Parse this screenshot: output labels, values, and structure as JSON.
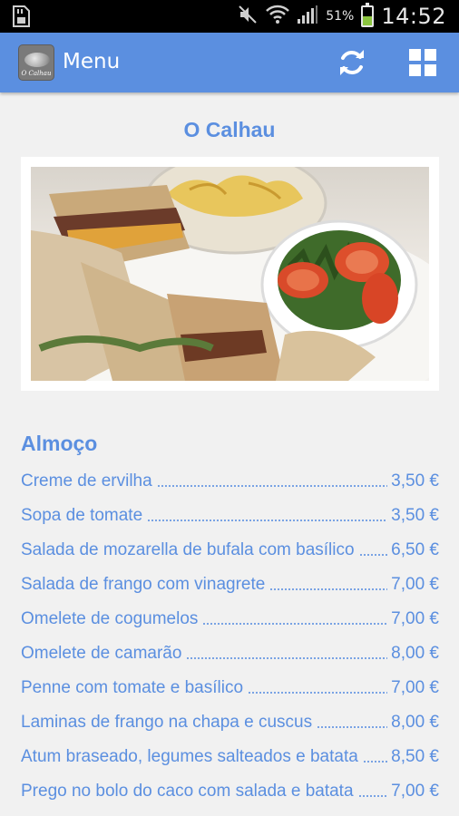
{
  "status_bar": {
    "battery_percent": "51%",
    "battery_level": 0.51,
    "time": "14:52",
    "icons": [
      "sd-card-icon",
      "mute-icon",
      "wifi-icon",
      "signal-icon",
      "battery-icon"
    ]
  },
  "action_bar": {
    "logo_text": "O Calhau",
    "title": "Menu",
    "refresh_icon": "refresh-icon",
    "grid_icon": "grid-icon"
  },
  "restaurant": {
    "name": "O Calhau"
  },
  "section": {
    "title": "Almoço",
    "items": [
      {
        "name": "Creme de ervilha",
        "price": "3,50 €"
      },
      {
        "name": "Sopa de tomate",
        "price": "3,50 €"
      },
      {
        "name": "Salada de mozarella de bufala com basílico",
        "price": "6,50 €"
      },
      {
        "name": "Salada de frango com vinagrete",
        "price": "7,00 €"
      },
      {
        "name": "Omelete de cogumelos",
        "price": "7,00 €"
      },
      {
        "name": "Omelete de camarão",
        "price": "8,00 €"
      },
      {
        "name": "Penne com tomate e basílico",
        "price": "7,00 €"
      },
      {
        "name": "Laminas de frango na chapa e cuscus",
        "price": "8,00 €"
      },
      {
        "name": "Atum braseado, legumes salteados e batata",
        "price": "8,50 €"
      },
      {
        "name": "Prego no bolo do caco com salada e batata",
        "price": "7,00 €"
      }
    ]
  },
  "colors": {
    "accent": "#5b8fe0",
    "background": "#f1f1f1",
    "status_bar": "#000000"
  }
}
